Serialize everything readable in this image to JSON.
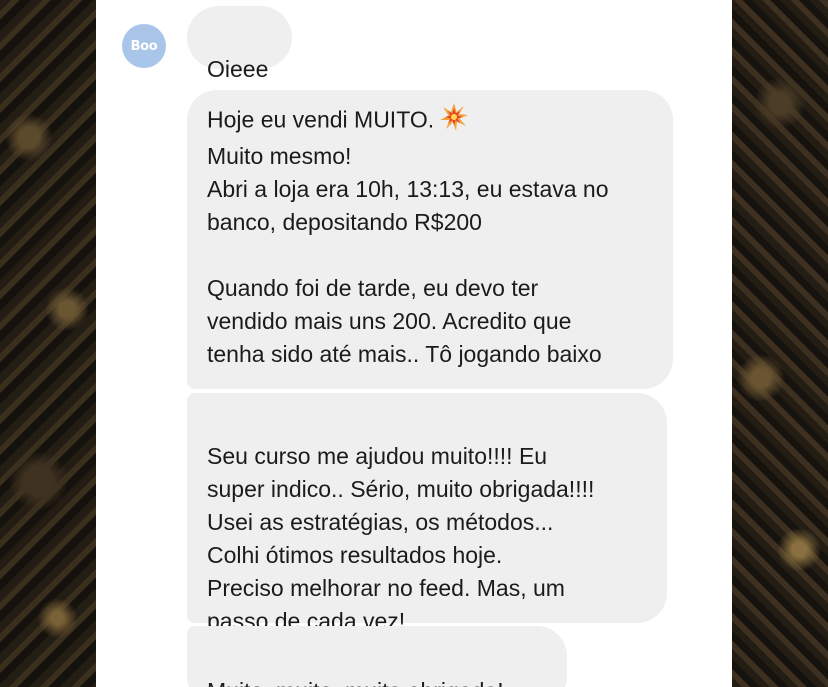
{
  "avatar": {
    "label": "Boo"
  },
  "messages": [
    {
      "text": "Oieee"
    },
    {
      "text": "Hoje eu vendi MUITO.",
      "emoji": "collision-emoji",
      "text_rest": "Muito mesmo!\nAbri a loja era 10h, 13:13, eu estava no\nbanco, depositando R$200\n\nQuando foi de tarde, eu devo ter\nvendido mais uns 200. Acredito que\ntenha sido até mais.. Tô jogando baixo"
    },
    {
      "text": "Seu curso me ajudou muito!!!! Eu\nsuper indico.. Sério, muito obrigada!!!!\nUsei as estratégias, os métodos...\nColhi ótimos resultados hoje.\nPreciso melhorar no feed. Mas, um\npasso de cada vez!"
    },
    {
      "text": "Muito, muito, muito obrigada!"
    }
  ],
  "colors": {
    "bubble": "#efeff0",
    "avatar": "#a9c6ea",
    "text": "#1b1b1b"
  }
}
